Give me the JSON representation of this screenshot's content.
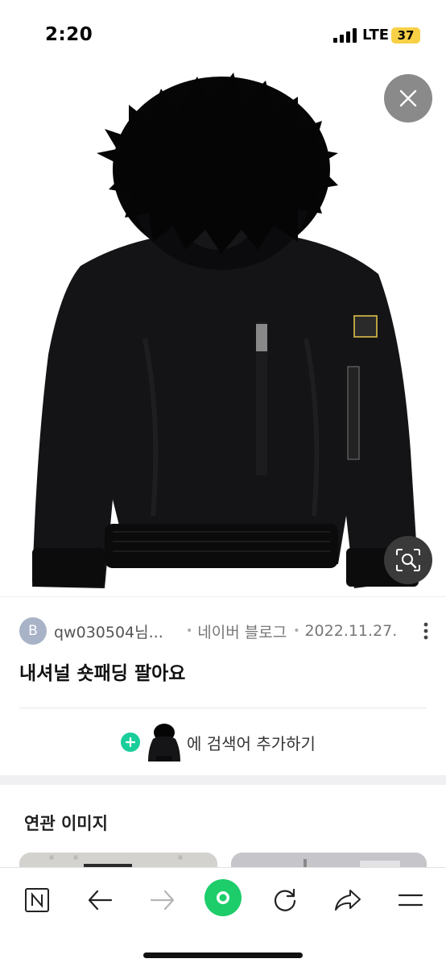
{
  "status_bar": {
    "time": "2:20",
    "network": "LTE",
    "battery": "37"
  },
  "hero": {
    "subject": "black short padded jacket with fur hood",
    "close_icon": "close-icon",
    "lens_icon": "image-search-icon"
  },
  "result": {
    "avatar_letter": "B",
    "author": "qw030504님...",
    "separator": "•",
    "source": "네이버 블로그",
    "date": "2022.11.27.",
    "title": "내셔널 숏패딩 팔아요"
  },
  "add_search": {
    "label": "에 검색어 추가하기"
  },
  "related": {
    "title": "연관 이미지"
  },
  "toolbar": {
    "items": [
      "naver-home-icon",
      "back-arrow-icon",
      "forward-arrow-icon",
      "green-dot-icon",
      "refresh-icon",
      "share-icon",
      "menu-icon"
    ]
  },
  "colors": {
    "accent": "#19ce9b",
    "close_bg": "#8a8a8a",
    "battery": "#f7d046"
  }
}
